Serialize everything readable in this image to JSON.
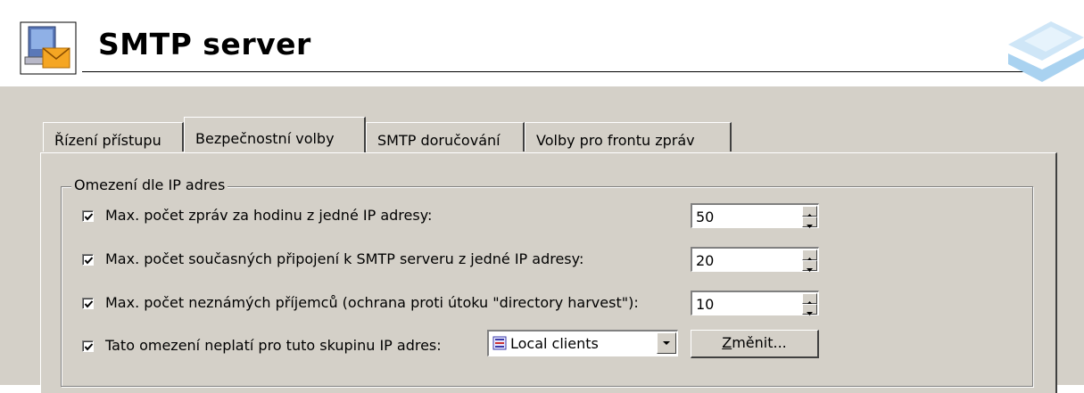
{
  "header": {
    "title": "SMTP server",
    "icon": "smtp-server-icon"
  },
  "tabs": [
    {
      "label": "Řízení přístupu",
      "active": false
    },
    {
      "label": "Bezpečnostní volby",
      "active": true
    },
    {
      "label": "SMTP doručování",
      "active": false
    },
    {
      "label": "Volby pro frontu zpráv",
      "active": false
    }
  ],
  "group": {
    "label": "Omezení dle IP adres",
    "rows": [
      {
        "label": "Max. počet zpráv za hodinu z jedné IP adresy:",
        "checked": true,
        "value": "50"
      },
      {
        "label": "Max. počet současných připojení k SMTP serveru z jedné IP adresy:",
        "checked": true,
        "value": "20"
      },
      {
        "label": "Max. počet neznámých příjemců (ochrana proti útoku \"directory harvest\"):",
        "checked": true,
        "value": "10"
      }
    ],
    "exception": {
      "label": "Tato omezení neplatí pro tuto skupinu IP adres:",
      "checked": true,
      "selected": "Local clients",
      "button_mnemonic": "Z",
      "button_rest": "měnit..."
    }
  }
}
